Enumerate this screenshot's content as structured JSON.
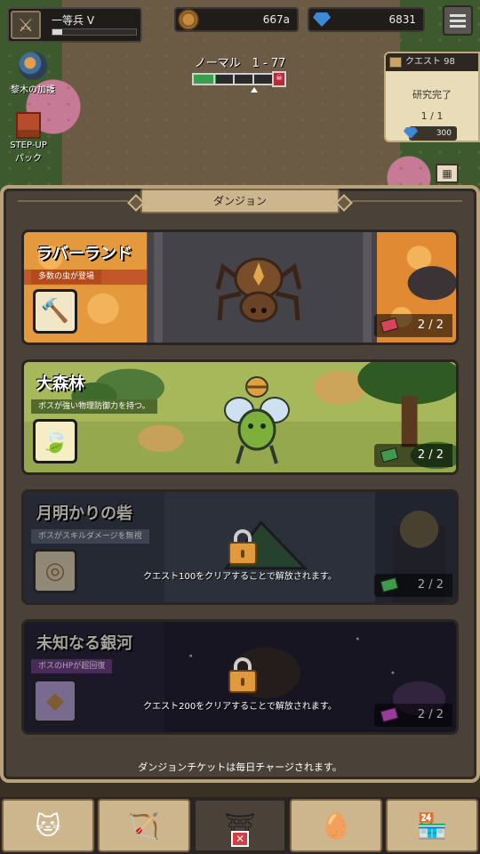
{
  "hud": {
    "rank_name": "一等兵 V",
    "rank_progress": 0.12,
    "coins": "667a",
    "gems": "6831",
    "weapon_icon": "sword-icon",
    "menu_icon": "hamburger-icon"
  },
  "stage": {
    "label": "ノーマル　1 - 77",
    "progress": 0.28,
    "boss_icon": "skull-icon"
  },
  "side": {
    "blessing_label": "黎木の加護",
    "stepup_label": "STEP-UP\nパック"
  },
  "quest": {
    "title": "クエスト 98",
    "status": "研究完了",
    "progress": "1 / 1",
    "reward": "300"
  },
  "panel": {
    "title": "ダンジョン",
    "footnote": "ダンジョンチケットは毎日チャージされます。"
  },
  "dungeons": [
    {
      "name": "ラバーランド",
      "desc": "多数の虫が登場",
      "count": "2 / 2",
      "item_icon": "hammer-icon",
      "boss_icon": "spider-icon",
      "locked": false
    },
    {
      "name": "大森林",
      "desc": "ボスが強い物理防御力を持つ。",
      "count": "2 / 2",
      "item_icon": "leaf-icon",
      "boss_icon": "bee-icon",
      "locked": false
    },
    {
      "name": "月明かりの砦",
      "desc": "ボスがスキルダメージを無視",
      "count": "2 / 2",
      "item_icon": "ring-icon",
      "boss_icon": "tent-icon",
      "locked": true,
      "lock_text": "クエスト100をクリアすることで解放されます。"
    },
    {
      "name": "未知なる銀河",
      "desc": "ボスのHPが超回復",
      "count": "2 / 2",
      "item_icon": "crystal-icon",
      "boss_icon": "bear-icon",
      "locked": true,
      "lock_text": "クエスト200をクリアすることで解放されます。"
    }
  ],
  "colors": {
    "lava": "#d97b2a",
    "forest": "#a7b85a",
    "moon": "#2f3a48",
    "galaxy": "#1c1a2e",
    "panel_border": "#b7a27b"
  },
  "nav": [
    {
      "icon": "cat-icon"
    },
    {
      "icon": "bow-icon"
    },
    {
      "icon": "dungeon-gate-icon",
      "active": true
    },
    {
      "icon": "egg-nest-icon"
    },
    {
      "icon": "shop-icon"
    }
  ]
}
